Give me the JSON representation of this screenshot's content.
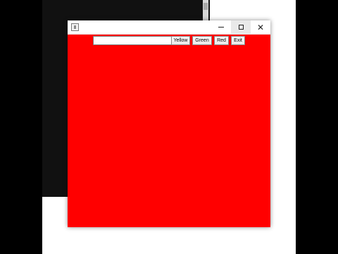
{
  "window": {
    "minimize_symbol": "—",
    "maximize_symbol": "☐",
    "close_symbol": "✕",
    "content_background": "#ff0000"
  },
  "toolbar": {
    "input_value": "",
    "yellow_label": "Yellow",
    "green_label": "Green",
    "red_label": "Red",
    "exit_label": "Exit"
  },
  "icons": {
    "app_icon": "java-app-icon",
    "minimize": "minimize-icon",
    "maximize": "maximize-icon",
    "close": "close-icon"
  }
}
